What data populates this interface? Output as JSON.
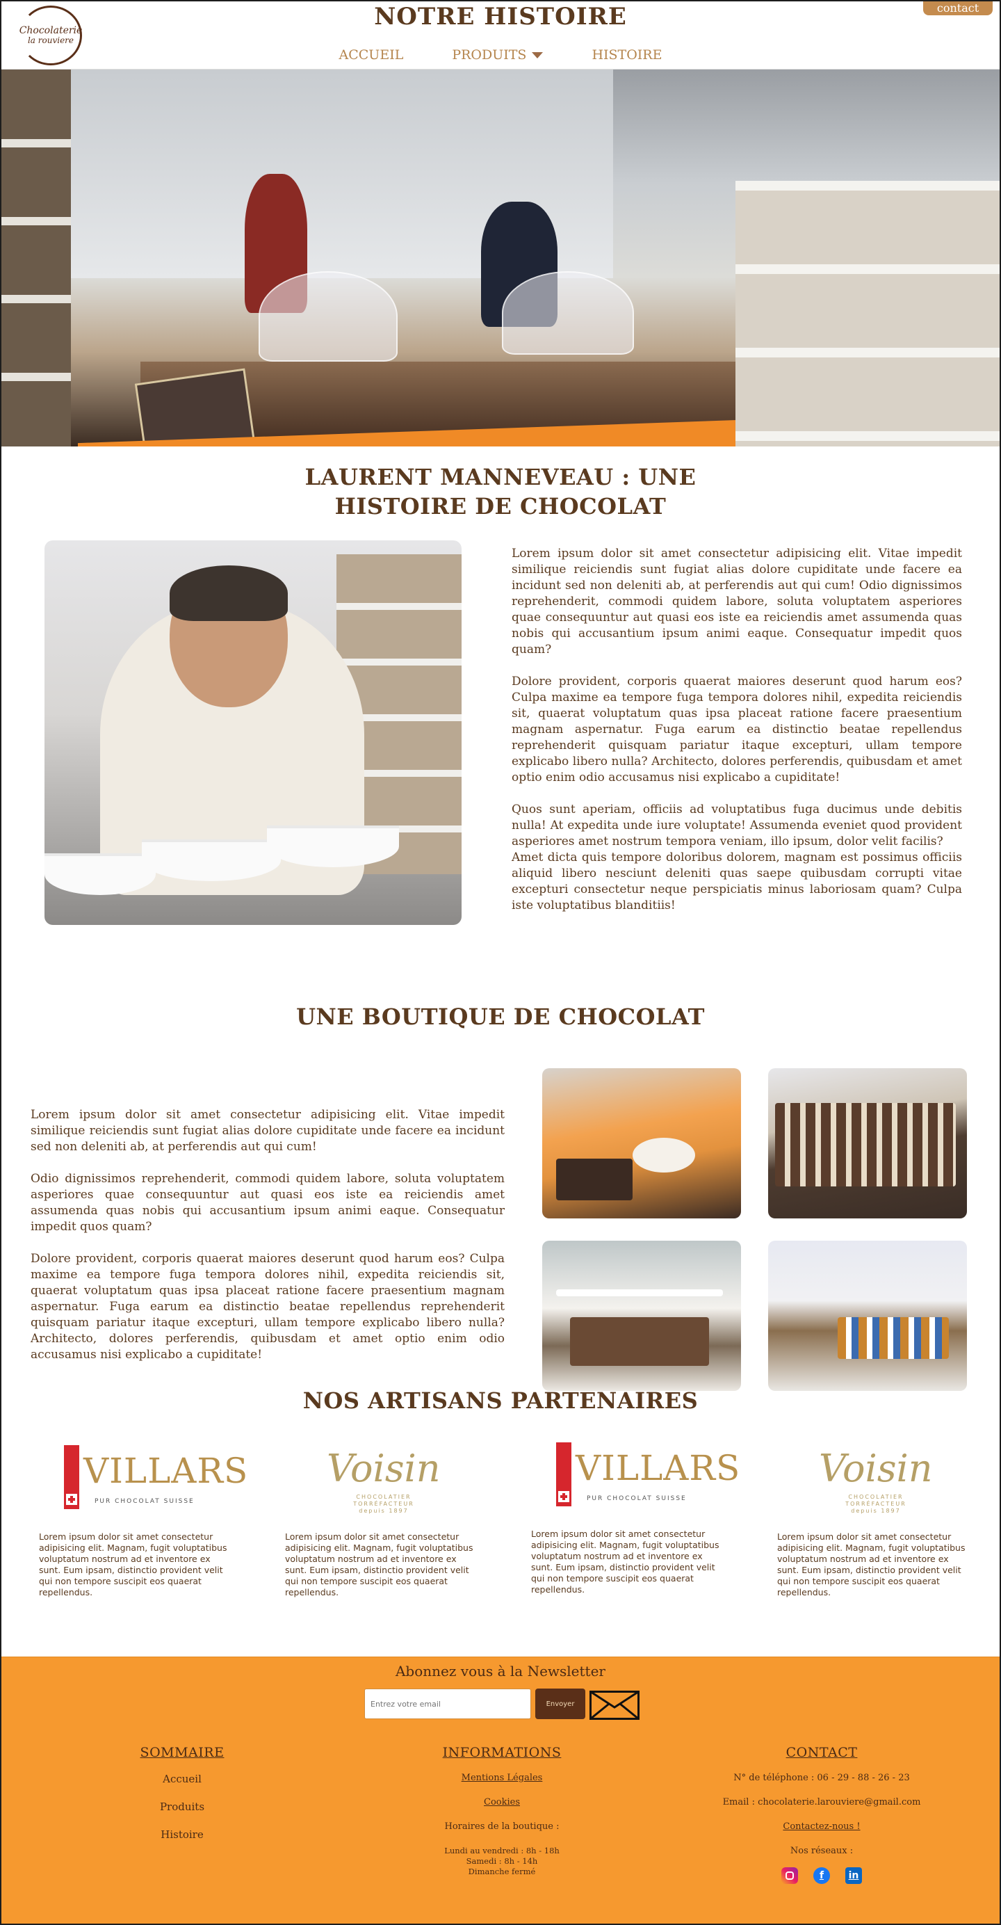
{
  "header": {
    "logo_line1": "Chocolaterie",
    "logo_line2": "la rouviere",
    "title": "NOTRE HISTOIRE",
    "nav": [
      "ACCUEIL",
      "PRODUITS",
      "HISTOIRE"
    ],
    "contact_button": "contact"
  },
  "story": {
    "title_line1": "LAURENT MANNEVEAU : UNE",
    "title_line2": "HISTOIRE DE CHOCOLAT",
    "p1": "Lorem ipsum dolor sit amet consectetur adipisicing elit. Vitae impedit similique reiciendis sunt fugiat alias dolore cupiditate unde facere ea incidunt sed non deleniti ab, at perferendis aut qui cum! Odio dignissimos reprehenderit, commodi quidem labore, soluta voluptatem asperiores quae consequuntur aut quasi eos iste ea reiciendis amet assumenda quas nobis qui accusantium ipsum animi eaque. Consequatur impedit quos quam?",
    "p2": "Dolore provident, corporis quaerat maiores deserunt quod harum eos? Culpa maxime ea tempore fuga tempora dolores nihil, expedita reiciendis sit, quaerat voluptatum quas ipsa placeat ratione facere praesentium magnam aspernatur. Fuga earum ea distinctio beatae repellendus reprehenderit quisquam pariatur itaque excepturi, ullam tempore explicabo libero nulla? Architecto, dolores perferendis, quibusdam et amet optio enim odio accusamus nisi explicabo a cupiditate!",
    "p3": "Quos sunt aperiam, officiis ad voluptatibus fuga ducimus unde debitis nulla! At expedita unde iure voluptate! Assumenda eveniet quod provident asperiores amet nostrum tempora veniam, illo ipsum, dolor velit facilis?",
    "p4": "Amet dicta quis tempore doloribus dolorem, magnam est possimus officiis aliquid libero nesciunt deleniti quas saepe quibusdam corrupti vitae excepturi consectetur neque perspiciatis minus laboriosam quam? Culpa iste voluptatibus blanditiis!"
  },
  "shop": {
    "title": "UNE BOUTIQUE DE CHOCOLAT",
    "p1": "Lorem ipsum dolor sit amet consectetur adipisicing elit. Vitae impedit similique reiciendis sunt fugiat alias dolore cupiditate unde facere ea incidunt sed non deleniti ab, at perferendis aut qui cum!",
    "p2": "Odio dignissimos reprehenderit, commodi quidem labore, soluta voluptatem asperiores quae consequuntur aut quasi eos iste ea reiciendis amet assumenda quas nobis qui accusantium ipsum animi eaque. Consequatur impedit quos quam?",
    "p3": "Dolore provident, corporis quaerat maiores deserunt quod harum eos? Culpa maxime ea tempore fuga tempora dolores nihil, expedita reiciendis sit, quaerat voluptatum quas ipsa placeat ratione facere praesentium magnam aspernatur. Fuga earum ea distinctio beatae repellendus reprehenderit quisquam pariatur itaque excepturi, ullam tempore explicabo libero nulla? Architecto, dolores perferendis, quibusdam et amet optio enim odio accusamus nisi explicabo a cupiditate!"
  },
  "partners": {
    "title": "NOS ARTISANS PARTENAIRES",
    "villars_name": "VILLARS",
    "villars_tagline": "PUR CHOCOLAT SUISSE",
    "voisin_name": "Voisin",
    "voisin_tagline_line1": "CHOCOLATIER",
    "voisin_tagline_line2": "TORRÉFACTEUR",
    "voisin_tagline_line3": "depuis 1897",
    "text": "Lorem ipsum dolor sit amet consectetur adipisicing elit. Magnam, fugit voluptatibus voluptatum nostrum ad et inventore ex sunt. Eum ipsam, distinctio provident velit qui non tempore suscipit eos quaerat repellendus."
  },
  "footer": {
    "newsletter_title": "Abonnez vous à la Newsletter",
    "email_placeholder": "Entrez votre email",
    "send_button": "Envoyer",
    "sommaire": {
      "title": "SOMMAIRE",
      "links": [
        "Accueil",
        "Produits",
        "Histoire"
      ]
    },
    "informations": {
      "title": "INFORMATIONS",
      "mentions": "Mentions Légales",
      "cookies": "Cookies",
      "hours_title": "Horaires de la boutique :",
      "hours_line1": "Lundi au vendredi : 8h - 18h",
      "hours_line2": "Samedi : 8h - 14h",
      "hours_line3": "Dimanche fermé"
    },
    "contact": {
      "title": "CONTACT",
      "phone": "N° de téléphone : 06 - 29 - 88 - 26 - 23",
      "email": "Email : chocolaterie.larouviere@gmail.com",
      "contact_us": "Contactez-nous !",
      "networks": "Nos réseaux :"
    }
  },
  "colors": {
    "brand_brown": "#5a3a1f",
    "nav_tan": "#b5854d",
    "footer_orange": "#f6992f",
    "villars_red": "#d6262d",
    "villars_gold": "#b8914d"
  },
  "icons": [
    "chevron-down-icon",
    "envelope-icon",
    "instagram-icon",
    "facebook-icon",
    "linkedin-icon"
  ]
}
